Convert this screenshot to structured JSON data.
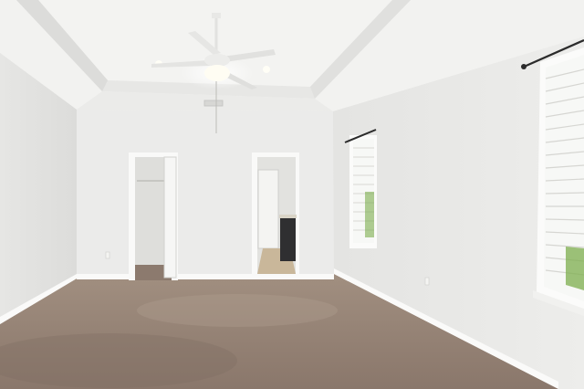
{
  "scene": {
    "description_free": true,
    "colors": {
      "ceiling": "#f4f4f2",
      "tray": "#ececea",
      "left_wall": "#e3e3e1",
      "back_wall": "#ebebea",
      "right_wall": "#e6e6e4",
      "carpet": "#8f7d71",
      "carpet_shadow": "#7a685d",
      "trim": "#fbfbfa",
      "window_light": "#f7f8f6",
      "foliage": "#7cae4c",
      "rod": "#2b2b2b",
      "cabinet": "#2f2f31",
      "hall_floor": "#c9b79a"
    },
    "objects": [
      "ceiling-fan",
      "recessed-light-left",
      "recessed-light-right",
      "air-vent",
      "closet-doorway",
      "bathroom-doorway",
      "window-middle",
      "window-right",
      "curtain-rod",
      "carpet-floor"
    ]
  }
}
